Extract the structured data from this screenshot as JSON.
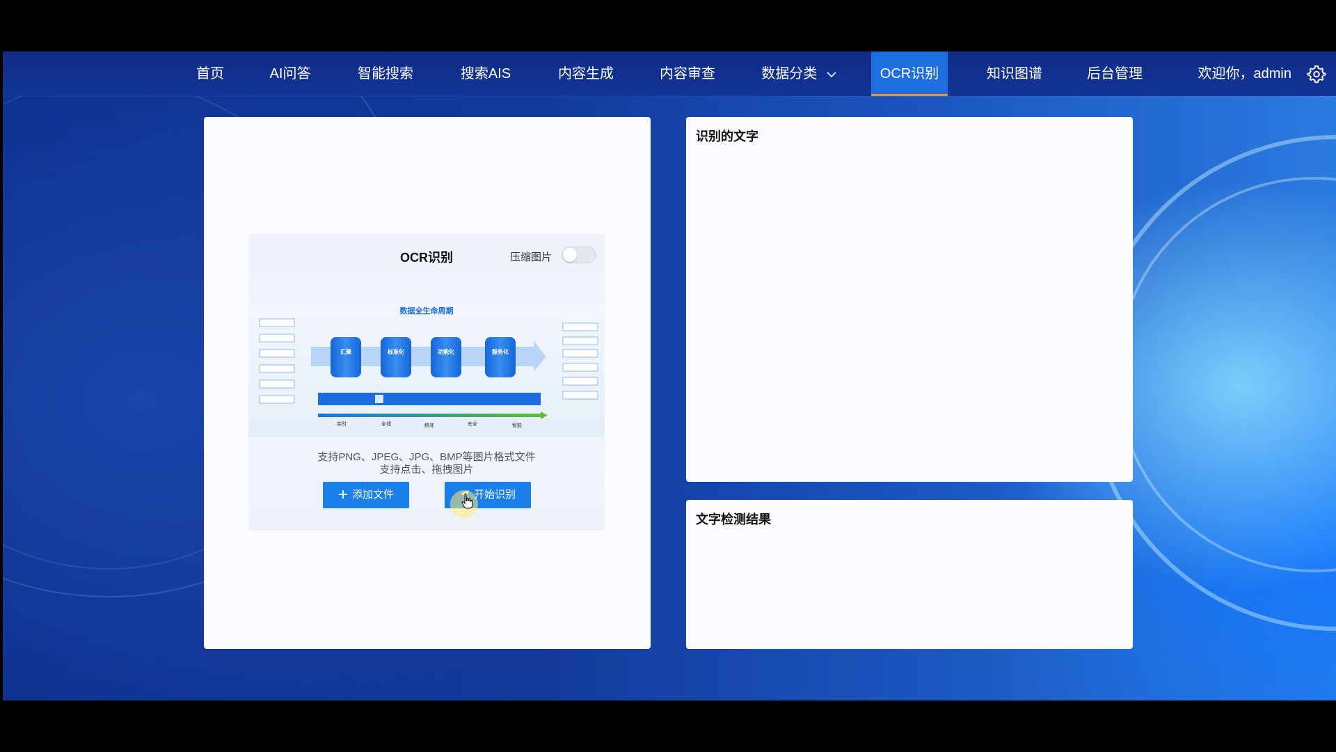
{
  "nav": {
    "items": [
      {
        "label": "首页"
      },
      {
        "label": "AI问答"
      },
      {
        "label": "智能搜索"
      },
      {
        "label": "搜索AIS"
      },
      {
        "label": "内容生成"
      },
      {
        "label": "内容审查"
      },
      {
        "label": "数据分类"
      },
      {
        "label": "OCR识别",
        "active": true
      },
      {
        "label": "知识图谱"
      },
      {
        "label": "后台管理"
      }
    ],
    "welcome": "欢迎你，admin",
    "settings_icon": "gear-icon",
    "dropdown_icon": "chevron-down-icon"
  },
  "upload": {
    "title": "OCR识别",
    "compress_label": "压缩图片",
    "compress_enabled": false,
    "hint_line1": "支持PNG、JPEG、JPG、BMP等图片格式文件",
    "hint_line2": "支持点击、拖拽图片",
    "add_button": "添加文件",
    "start_button": "开始识别",
    "preview": {
      "heading": "数据全生命周期",
      "stages": [
        "汇聚",
        "标准化",
        "功能化",
        "服务化"
      ],
      "bottom_labels": [
        "实时",
        "全域",
        "精准",
        "安全",
        "智能"
      ]
    }
  },
  "results": {
    "recognized_title": "识别的文字",
    "detection_title": "文字检测结果"
  },
  "colors": {
    "accent": "#1a7fe8",
    "nav_bg": "#143596",
    "active_tab": "#1f6ee0",
    "active_underline": "#ff8c2a"
  }
}
